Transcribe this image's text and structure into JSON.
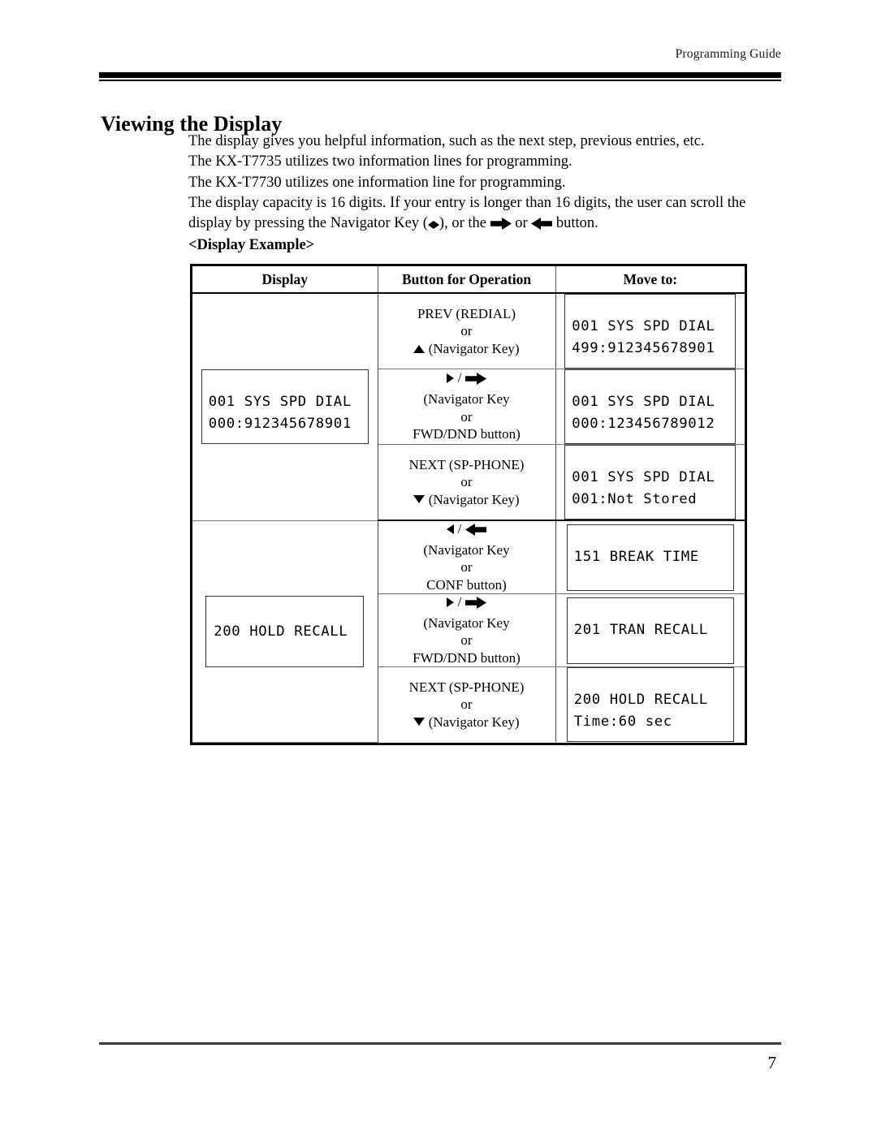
{
  "header": {
    "running_head": "Programming Guide"
  },
  "title": "Viewing the Display",
  "intro": {
    "line1": "The display gives you helpful information, such as the next step, previous entries, etc.",
    "line2": "The KX-T7735 utilizes two information lines for programming.",
    "line3": "The KX-T7730 utilizes one information line for programming.",
    "line4a": "The display capacity is 16 digits. If your entry is longer than 16 digits, the user can scroll the",
    "line4b_pre": "display by pressing the Navigator Key (",
    "line4b_mid": "), or the ",
    "line4b_or": " or ",
    "line4b_post": " button."
  },
  "display_example_label": "<Display Example>",
  "table": {
    "columns": [
      "Display",
      "Button for Operation",
      "Move to:"
    ],
    "groups": [
      {
        "display": {
          "lines": [
            "001 SYS SPD DIAL",
            "000:912345678901"
          ]
        },
        "rows": [
          {
            "button": {
              "name": "PREV (REDIAL)",
              "or": "or",
              "key": "(Navigator Key)",
              "glyph": "triangle-up-icon"
            },
            "moveto": {
              "lines": [
                "001 SYS SPD DIAL",
                "499:912345678901"
              ]
            }
          },
          {
            "button": {
              "glyph_left": "triangle-right-icon",
              "slash": "/",
              "glyph_right": "block-arrow-right-icon",
              "name": "(Navigator Key",
              "or": "or",
              "key": "FWD/DND button)"
            },
            "moveto": {
              "lines": [
                "001 SYS SPD DIAL",
                "000:123456789012"
              ]
            }
          },
          {
            "button": {
              "name": "NEXT (SP-PHONE)",
              "or": "or",
              "key": "(Navigator Key)",
              "glyph": "triangle-down-icon"
            },
            "moveto": {
              "lines": [
                "001 SYS SPD DIAL",
                "001:Not Stored"
              ]
            }
          }
        ]
      },
      {
        "display": {
          "lines": [
            "200 HOLD RECALL"
          ]
        },
        "rows": [
          {
            "button": {
              "glyph_left": "triangle-left-icon",
              "slash": "/",
              "glyph_right": "block-arrow-left-icon",
              "name": "(Navigator Key",
              "or": "or",
              "key": "CONF button)"
            },
            "moveto": {
              "lines": [
                "151 BREAK TIME"
              ]
            }
          },
          {
            "button": {
              "glyph_left": "triangle-right-icon",
              "slash": "/",
              "glyph_right": "block-arrow-right-icon",
              "name": "(Navigator Key",
              "or": "or",
              "key": "FWD/DND button)"
            },
            "moveto": {
              "lines": [
                "201 TRAN RECALL"
              ]
            }
          },
          {
            "button": {
              "name": "NEXT (SP-PHONE)",
              "or": "or",
              "key": "(Navigator Key)",
              "glyph": "triangle-down-icon"
            },
            "moveto": {
              "lines": [
                "200 HOLD RECALL",
                "Time:60 sec"
              ]
            }
          }
        ]
      }
    ]
  },
  "footer": {
    "page_number": "7"
  }
}
